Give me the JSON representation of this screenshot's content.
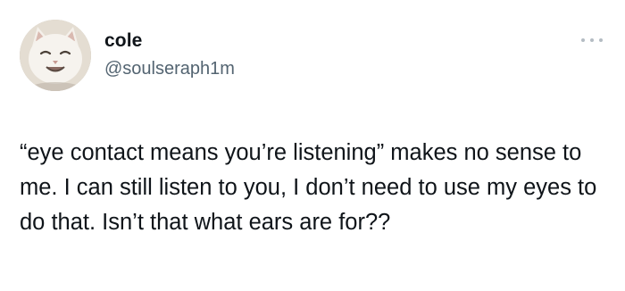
{
  "tweet": {
    "display_name": "cole",
    "handle": "@soulseraph1m",
    "text": "“eye contact means you’re listening” makes no sense to me. I can still listen to you, I don’t need to use my eyes to do that. Isn’t that what ears are for??",
    "more_icon": "more-horizontal-icon",
    "avatar_icon": "avatar-cat"
  },
  "colors": {
    "text": "#0f1419",
    "handle": "#536471",
    "more_dots": "#b4bcc3"
  }
}
